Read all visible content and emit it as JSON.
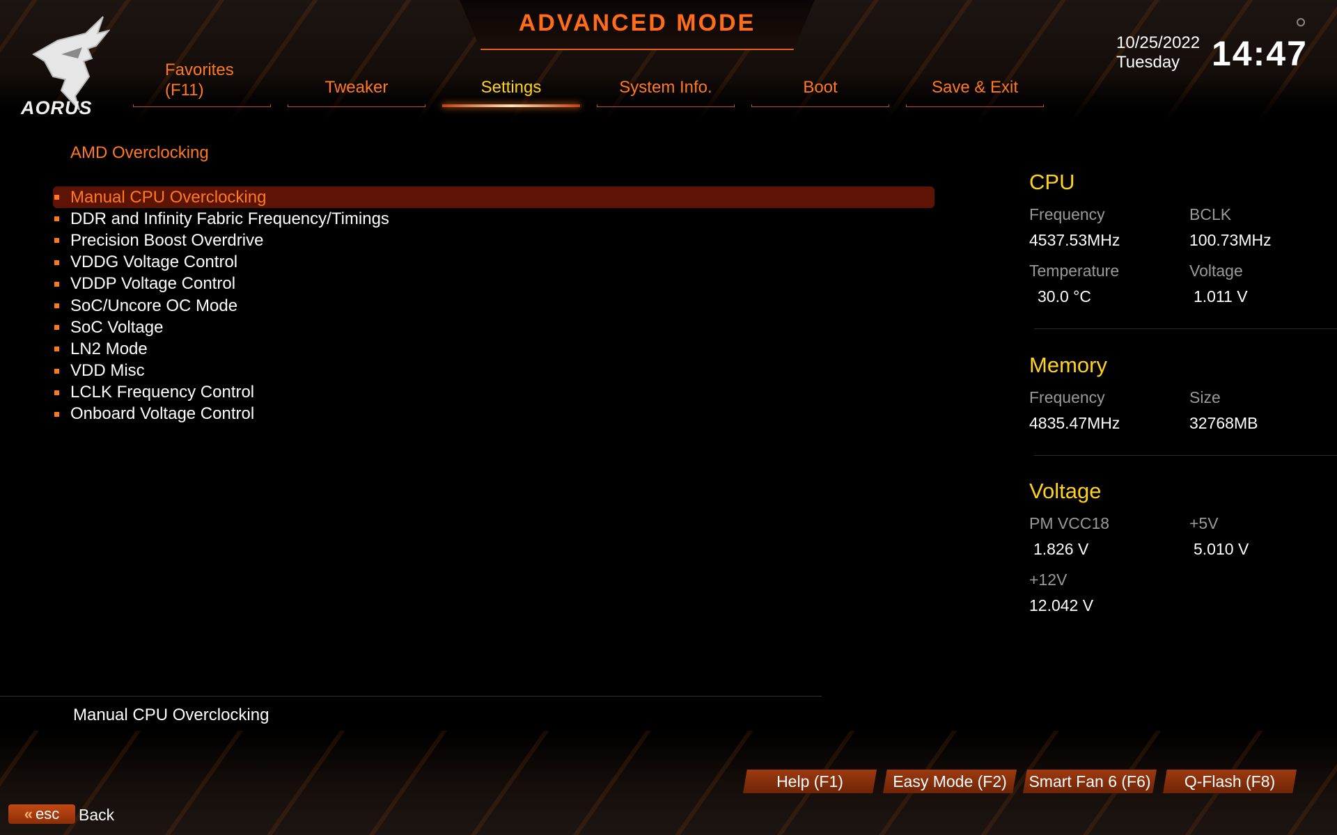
{
  "header": {
    "mode_title": "ADVANCED MODE",
    "logo_text": "AORUS",
    "date": "10/25/2022",
    "day": "Tuesday",
    "time": "14:47"
  },
  "tabs": [
    {
      "label": "Favorites\n(F11)"
    },
    {
      "label": "Tweaker"
    },
    {
      "label": "Settings",
      "active": true
    },
    {
      "label": "System Info."
    },
    {
      "label": "Boot"
    },
    {
      "label": "Save & Exit"
    }
  ],
  "main": {
    "section_title": "AMD Overclocking",
    "items": [
      {
        "label": "Manual CPU Overclocking",
        "selected": true
      },
      {
        "label": "DDR and Infinity Fabric Frequency/Timings"
      },
      {
        "label": "Precision Boost Overdrive"
      },
      {
        "label": "VDDG Voltage Control"
      },
      {
        "label": "VDDP Voltage Control"
      },
      {
        "label": "SoC/Uncore OC Mode"
      },
      {
        "label": "SoC Voltage"
      },
      {
        "label": "LN2 Mode"
      },
      {
        "label": "VDD Misc"
      },
      {
        "label": "LCLK Frequency Control"
      },
      {
        "label": "Onboard Voltage Control"
      }
    ],
    "help_text": "Manual CPU Overclocking"
  },
  "monitor": {
    "cpu": {
      "heading": "CPU",
      "frequency_label": "Frequency",
      "frequency": "4537.53MHz",
      "bclk_label": "BCLK",
      "bclk": "100.73MHz",
      "temperature_label": "Temperature",
      "temperature": "30.0 °C",
      "voltage_label": "Voltage",
      "voltage": "1.011 V"
    },
    "memory": {
      "heading": "Memory",
      "frequency_label": "Frequency",
      "frequency": "4835.47MHz",
      "size_label": "Size",
      "size": "32768MB"
    },
    "voltage": {
      "heading": "Voltage",
      "pm_vcc18_label": "PM VCC18",
      "pm_vcc18": "1.826 V",
      "v5_label": "+5V",
      "v5": "5.010 V",
      "v12_label": "+12V",
      "v12": "12.042 V"
    }
  },
  "footer": {
    "buttons": [
      {
        "label": "Help (F1)"
      },
      {
        "label": "Easy Mode (F2)"
      },
      {
        "label": "Smart Fan 6 (F6)"
      },
      {
        "label": "Q-Flash (F8)"
      }
    ],
    "esc_label": "esc",
    "back_label": "Back"
  },
  "colors": {
    "accent_orange": "#ff7a1e",
    "heading_yellow": "#ffd21c",
    "selected_bg": "#5e1404"
  }
}
